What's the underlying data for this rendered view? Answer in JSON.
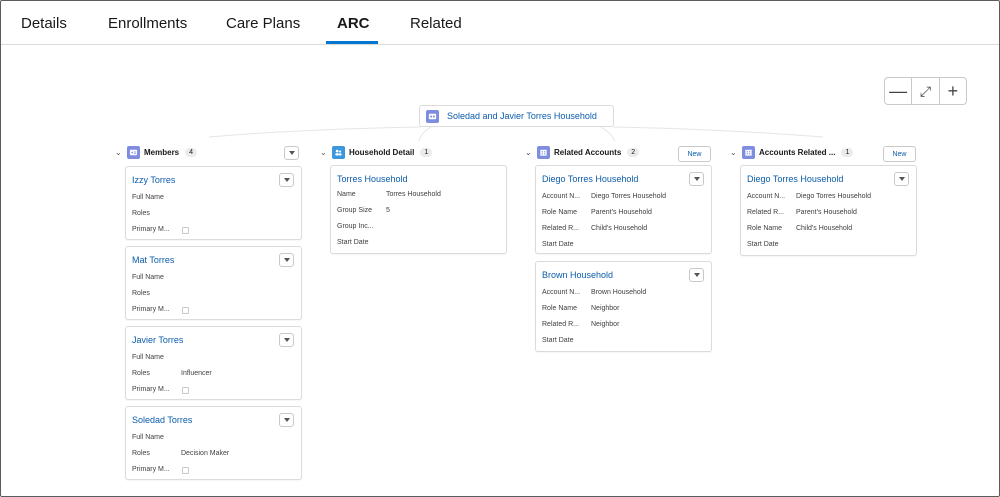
{
  "tabs": [
    {
      "label": "Details"
    },
    {
      "label": "Enrollments"
    },
    {
      "label": "Care Plans"
    },
    {
      "label": "ARC"
    },
    {
      "label": "Related"
    }
  ],
  "root": {
    "label": "Soledad and Javier Torres Household"
  },
  "zoom": {
    "minus": "—",
    "fit": "⤢",
    "plus": "+"
  },
  "columns": {
    "members": {
      "title": "Members",
      "count": "4"
    },
    "household": {
      "title": "Household Detail",
      "count": "1"
    },
    "related_accounts": {
      "title": "Related Accounts",
      "count": "2",
      "new_label": "New"
    },
    "accounts_related": {
      "title": "Accounts Related ...",
      "count": "1",
      "new_label": "New"
    }
  },
  "members": [
    {
      "name": "Izzy Torres",
      "full_name_label": "Full Name",
      "full_name": "",
      "roles_label": "Roles",
      "roles": "",
      "primary_label": "Primary M..."
    },
    {
      "name": "Mat Torres",
      "full_name_label": "Full Name",
      "full_name": "",
      "roles_label": "Roles",
      "roles": "",
      "primary_label": "Primary M..."
    },
    {
      "name": "Javier Torres",
      "full_name_label": "Full Name",
      "full_name": "",
      "roles_label": "Roles",
      "roles": "Influencer",
      "primary_label": "Primary M..."
    },
    {
      "name": "Soledad Torres",
      "full_name_label": "Full Name",
      "full_name": "",
      "roles_label": "Roles",
      "roles": "Decision Maker",
      "primary_label": "Primary M..."
    }
  ],
  "household": {
    "name": "Torres Household",
    "rows": [
      {
        "label": "Name",
        "value": "Torres Household"
      },
      {
        "label": "Group Size",
        "value": "5"
      },
      {
        "label": "Group Inc...",
        "value": ""
      },
      {
        "label": "Start Date",
        "value": ""
      }
    ]
  },
  "related_accounts": [
    {
      "name": "Diego Torres Household",
      "rows": [
        {
          "label": "Account N...",
          "value": "Diego Torres Household"
        },
        {
          "label": "Role Name",
          "value": "Parent's Household"
        },
        {
          "label": "Related R...",
          "value": "Child's Household"
        },
        {
          "label": "Start Date",
          "value": ""
        }
      ]
    },
    {
      "name": "Brown Household",
      "rows": [
        {
          "label": "Account N...",
          "value": "Brown Household"
        },
        {
          "label": "Role Name",
          "value": "Neighbor"
        },
        {
          "label": "Related R...",
          "value": "Neighbor"
        },
        {
          "label": "Start Date",
          "value": ""
        }
      ]
    }
  ],
  "accounts_related": [
    {
      "name": "Diego Torres Household",
      "rows": [
        {
          "label": "Account N...",
          "value": "Diego Torres Household"
        },
        {
          "label": "Related R...",
          "value": "Parent's Household"
        },
        {
          "label": "Role Name",
          "value": "Child's Household"
        },
        {
          "label": "Start Date",
          "value": ""
        }
      ]
    }
  ],
  "colors": {
    "accent": "#0176d3",
    "link": "#0b5cab",
    "object_icon": "#7f8de1",
    "household_icon": "#3c97dd"
  }
}
